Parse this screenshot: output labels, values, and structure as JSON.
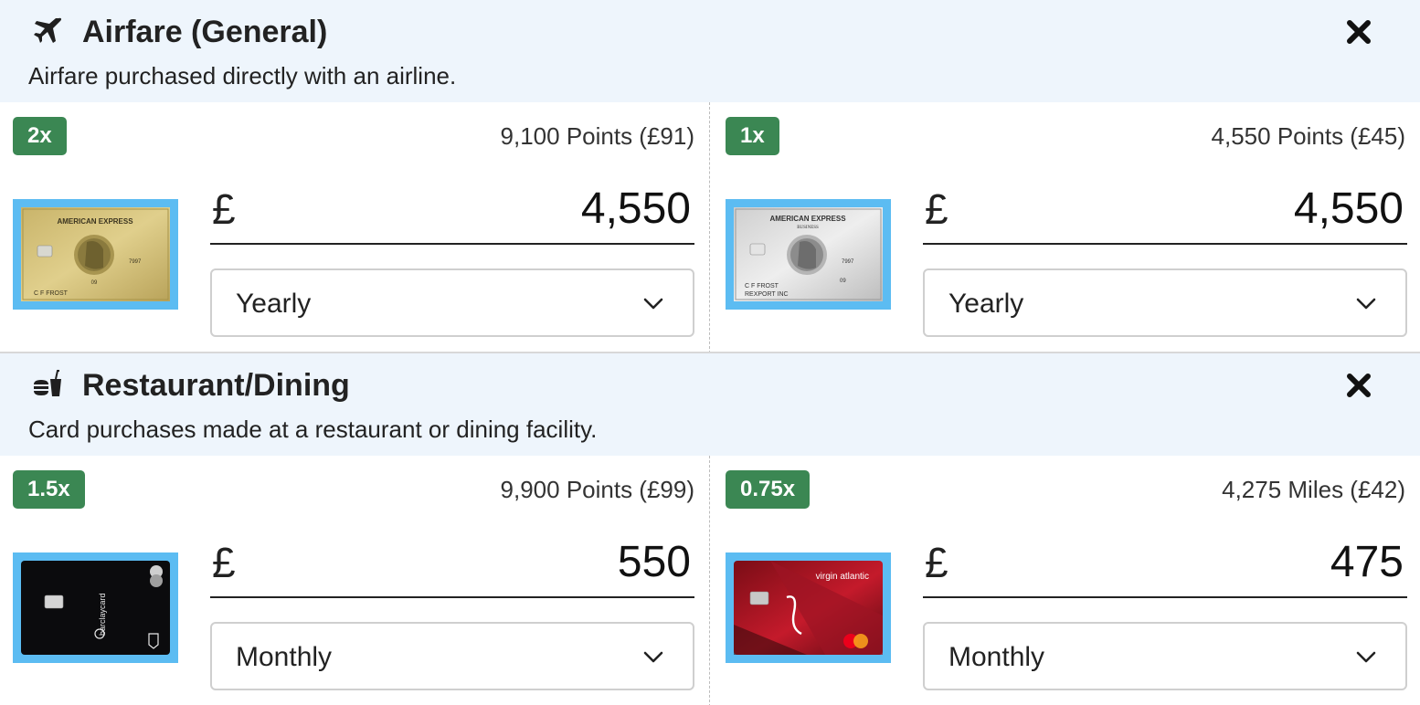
{
  "sections": [
    {
      "icon": "airplane-icon",
      "title": "Airfare (General)",
      "description": "Airfare purchased directly with an airline.",
      "close_icon": "close-icon",
      "cards": [
        {
          "multiplier": "2x",
          "earnings": "9,100 Points (£91)",
          "card_image": "amex-gold-card",
          "card_brand_text": "AMERICAN EXPRESS",
          "card_holder": "C F FROST",
          "currency": "£",
          "amount": "4,550",
          "frequency": "Yearly"
        },
        {
          "multiplier": "1x",
          "earnings": "4,550 Points (£45)",
          "card_image": "amex-business-platinum-card",
          "card_brand_text": "AMERICAN EXPRESS",
          "card_subbrand_text": "BUSINESS",
          "card_holder": "C F FROST",
          "card_company": "REXPORT INC",
          "currency": "£",
          "amount": "4,550",
          "frequency": "Yearly"
        }
      ]
    },
    {
      "icon": "fast-food-icon",
      "title": "Restaurant/Dining",
      "description": "Card purchases made at a restaurant or dining facility.",
      "close_icon": "close-icon",
      "cards": [
        {
          "multiplier": "1.5x",
          "earnings": "9,900 Points (£99)",
          "card_image": "barclaycard-black-card",
          "card_brand_text": "barclaycard",
          "currency": "£",
          "amount": "550",
          "frequency": "Monthly"
        },
        {
          "multiplier": "0.75x",
          "earnings": "4,275 Miles (£42)",
          "card_image": "virgin-atlantic-card",
          "card_brand_text": "virgin atlantic",
          "currency": "£",
          "amount": "475",
          "frequency": "Monthly"
        }
      ]
    }
  ],
  "colors": {
    "section_header_bg": "#eef5fc",
    "badge_bg": "#3b8753",
    "card_frame": "#5cbcf2"
  }
}
